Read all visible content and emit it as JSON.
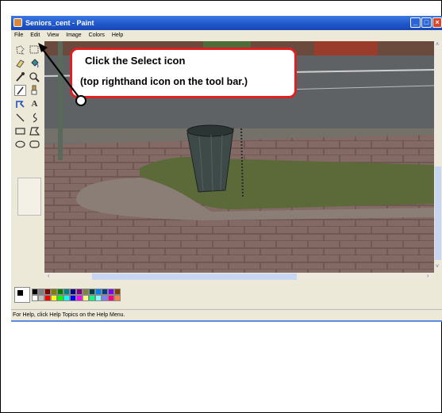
{
  "window": {
    "title": "Seniors_cent - Paint",
    "minimize_glyph": "_",
    "maximize_glyph": "□",
    "close_glyph": "×"
  },
  "menu": {
    "items": [
      "File",
      "Edit",
      "View",
      "Image",
      "Colors",
      "Help"
    ]
  },
  "toolbox": {
    "tools": [
      "free-form-select-icon",
      "select-icon",
      "eraser-icon",
      "fill-with-color-icon",
      "pick-color-icon",
      "magnifier-icon",
      "pencil-icon",
      "brush-icon",
      "airbrush-icon",
      "text-icon",
      "line-icon",
      "curve-icon",
      "rectangle-icon",
      "polygon-icon",
      "ellipse-icon",
      "rounded-rectangle-icon"
    ],
    "text_tool_glyph": "A"
  },
  "scrollbars": {
    "up_arrow": "˄",
    "down_arrow": "˅",
    "left_arrow": "‹",
    "right_arrow": "›"
  },
  "palette": {
    "foreground": "#000000",
    "background": "#ffffff",
    "top_row": [
      "#000000",
      "#808080",
      "#800000",
      "#808000",
      "#008000",
      "#008080",
      "#000080",
      "#800080",
      "#808040",
      "#004040",
      "#0080ff",
      "#004080",
      "#8000ff",
      "#804000"
    ],
    "bottom_row": [
      "#ffffff",
      "#c0c0c0",
      "#ff0000",
      "#ffff00",
      "#00ff00",
      "#00ffff",
      "#0000ff",
      "#ff00ff",
      "#ffff80",
      "#00ff80",
      "#80ffff",
      "#8080ff",
      "#ff0080",
      "#ff8040"
    ]
  },
  "status_bar": {
    "text": "For Help, click Help Topics on the Help Menu."
  },
  "callout": {
    "line1": "Click the Select  icon",
    "line2": "(top righthand icon on the tool bar.)",
    "border_color": "#e02020"
  }
}
